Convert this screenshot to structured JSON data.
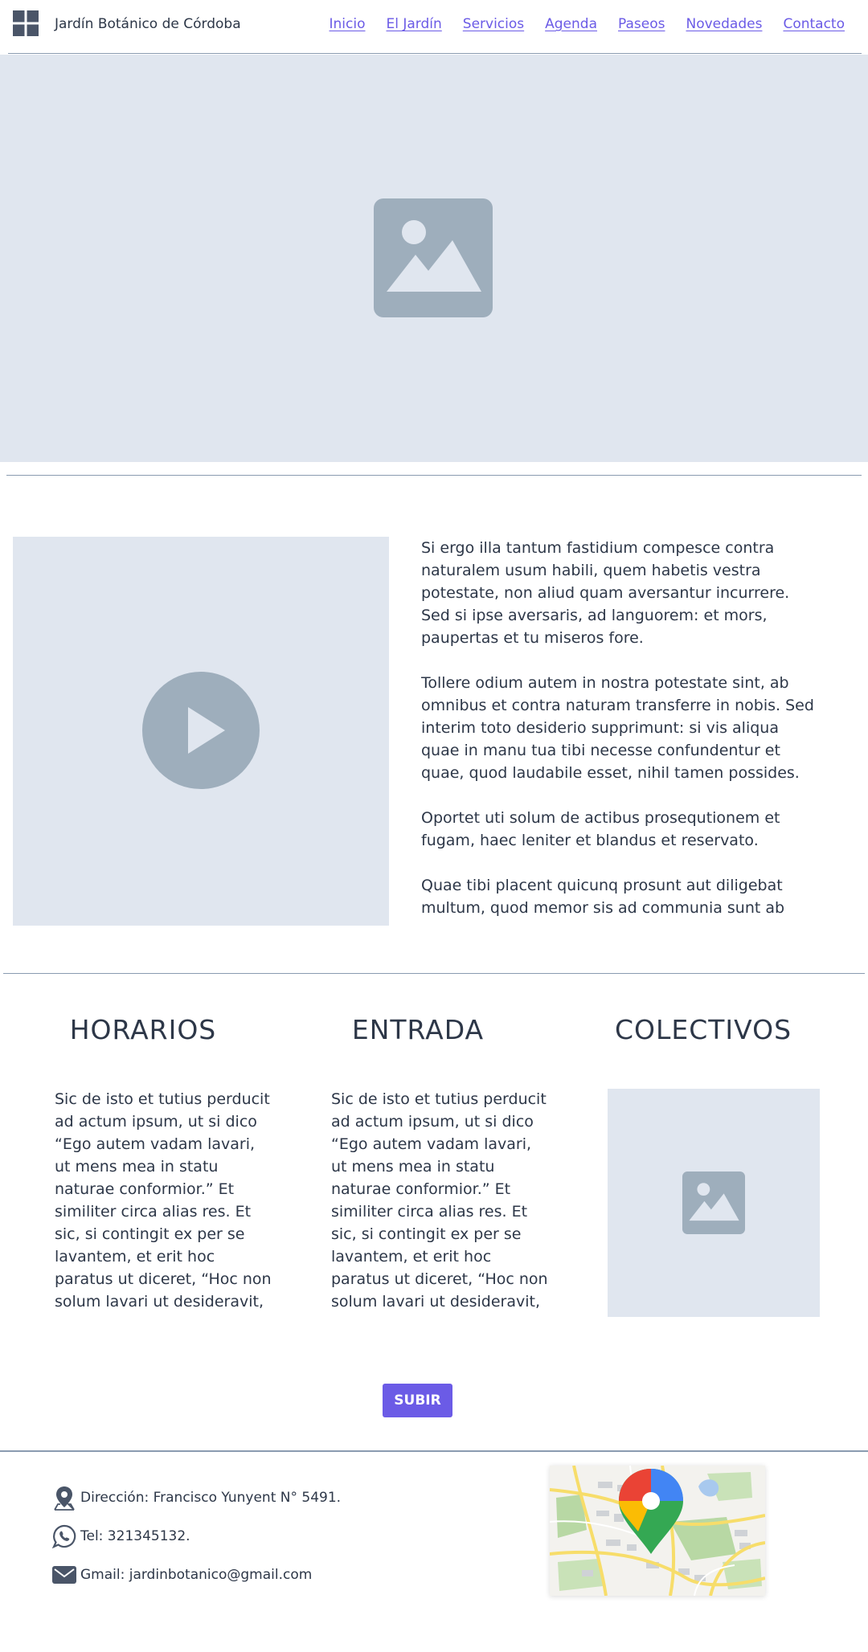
{
  "header": {
    "site_title": "Jardín Botánico de Córdoba",
    "logo_icon": "grid-logo-icon",
    "nav": [
      {
        "label": "Inicio"
      },
      {
        "label": "El Jardín"
      },
      {
        "label": "Servicios"
      },
      {
        "label": "Agenda"
      },
      {
        "label": "Paseos"
      },
      {
        "label": "Novedades"
      },
      {
        "label": "Contacto"
      }
    ]
  },
  "hero": {
    "icon": "image-placeholder-icon"
  },
  "intro": {
    "video_icon": "play-icon",
    "paragraphs": [
      "Si ergo illa tantum fastidium compesce contra naturalem usum habili, quem habetis vestra potestate, non aliud quam aversantur incurrere. Sed si ipse aversaris, ad languorem: et mors, paupertas et tu miseros fore.",
      "Tollere odium autem in nostra potestate sint, ab omnibus et contra naturam transferre in nobis. Sed interim toto desiderio supprimunt: si vis aliqua quae in manu tua tibi necesse confundentur et quae, quod laudabile esset, nihil tamen possides.",
      "Oportet uti solum de actibus prosequtionem et fugam, haec leniter et blandus et reservato.",
      "Quae tibi placent quicunq prosunt aut diligebat multum, quod memor sis ad communia sunt ab initio"
    ]
  },
  "columns": [
    {
      "title": "HORARIOS",
      "text": "Sic de isto et tutius perducit ad actum ipsum, ut si dico “Ego autem vadam lavari, ut mens mea in statu naturae conformior.” Et similiter circa alias res. Et sic, si contingit ex per se lavantem, et erit hoc paratus ut diceret, “Hoc non solum lavari ut desideravit, sed ut animus in"
    },
    {
      "title": "ENTRADA",
      "text": "Sic de isto et tutius perducit ad actum ipsum, ut si dico “Ego autem vadam lavari, ut mens mea in statu naturae conformior.” Et similiter circa alias res. Et sic, si contingit ex per se lavantem, et erit hoc paratus ut diceret, “Hoc non solum lavari ut desideravit, sed ut animus in"
    },
    {
      "title": "COLECTIVOS",
      "image_icon": "image-placeholder-icon"
    }
  ],
  "button": {
    "label": "SUBIR"
  },
  "footer": {
    "address": "Dirección: Francisco Yunyent N° 5491.",
    "phone": "Tel: 321345132.",
    "email": "Gmail: jardinbotanico@gmail.com",
    "icons": [
      "location-pin-icon",
      "whatsapp-icon",
      "mail-icon",
      "google-maps-icon"
    ]
  },
  "colors": {
    "accent": "#6b5be6",
    "placeholder_bg": "#e0e6ef",
    "placeholder_icon": "#9eaebc",
    "text": "#2d3748",
    "rule": "#8a9bb0"
  }
}
